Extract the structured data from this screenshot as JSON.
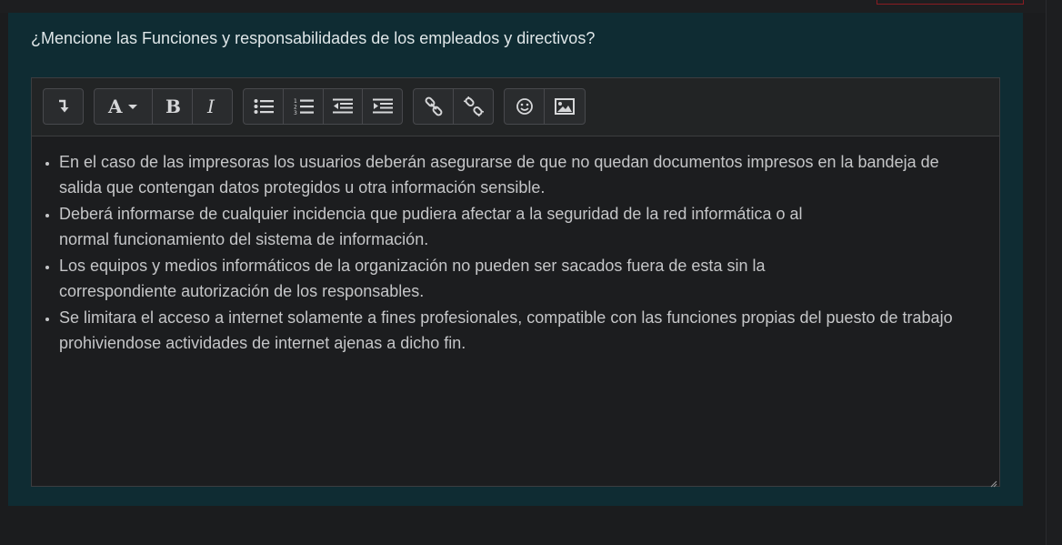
{
  "question": {
    "text": "¿Mencione las Funciones y responsabilidades de los empleados y directivos?"
  },
  "toolbar": {
    "groups": [
      {
        "buttons": [
          {
            "icon": "collapse-toolbar-icon"
          }
        ]
      },
      {
        "buttons": [
          {
            "icon": "font-style-icon"
          },
          {
            "icon": "bold-icon"
          },
          {
            "icon": "italic-icon"
          }
        ]
      },
      {
        "buttons": [
          {
            "icon": "unordered-list-icon"
          },
          {
            "icon": "ordered-list-icon"
          },
          {
            "icon": "outdent-icon"
          },
          {
            "icon": "indent-icon"
          }
        ]
      },
      {
        "buttons": [
          {
            "icon": "link-icon"
          },
          {
            "icon": "unlink-icon"
          }
        ]
      },
      {
        "buttons": [
          {
            "icon": "emoji-icon"
          },
          {
            "icon": "image-icon"
          }
        ]
      }
    ]
  },
  "editor": {
    "items": [
      {
        "line1": "En el caso de las impresoras los usuarios deberán asegurarse de que no quedan documentos impresos en la bandeja de",
        "line2": "salida que contengan datos protegidos u otra información sensible."
      },
      {
        "line1": "Deberá informarse de cualquier incidencia que pudiera afectar a la seguridad de la red informática o al",
        "line2": "normal funcionamiento del sistema de información."
      },
      {
        "line1": "Los equipos y medios informáticos de la organización no pueden ser sacados fuera de esta sin la",
        "line2": "correspondiente autorización de los responsables."
      },
      {
        "line1": "Se limitara el acceso a internet solamente a fines profesionales, compatible con las funciones propias del puesto de trabajo",
        "line2": "prohiviendose actividades de internet ajenas a dicho fin."
      }
    ]
  },
  "colors": {
    "card_bg": "#0f2c33",
    "page_bg": "#1b1c1e",
    "editor_bg": "#1c1d1f",
    "text": "#c5c6c8",
    "accent_red": "#8a1c22"
  }
}
